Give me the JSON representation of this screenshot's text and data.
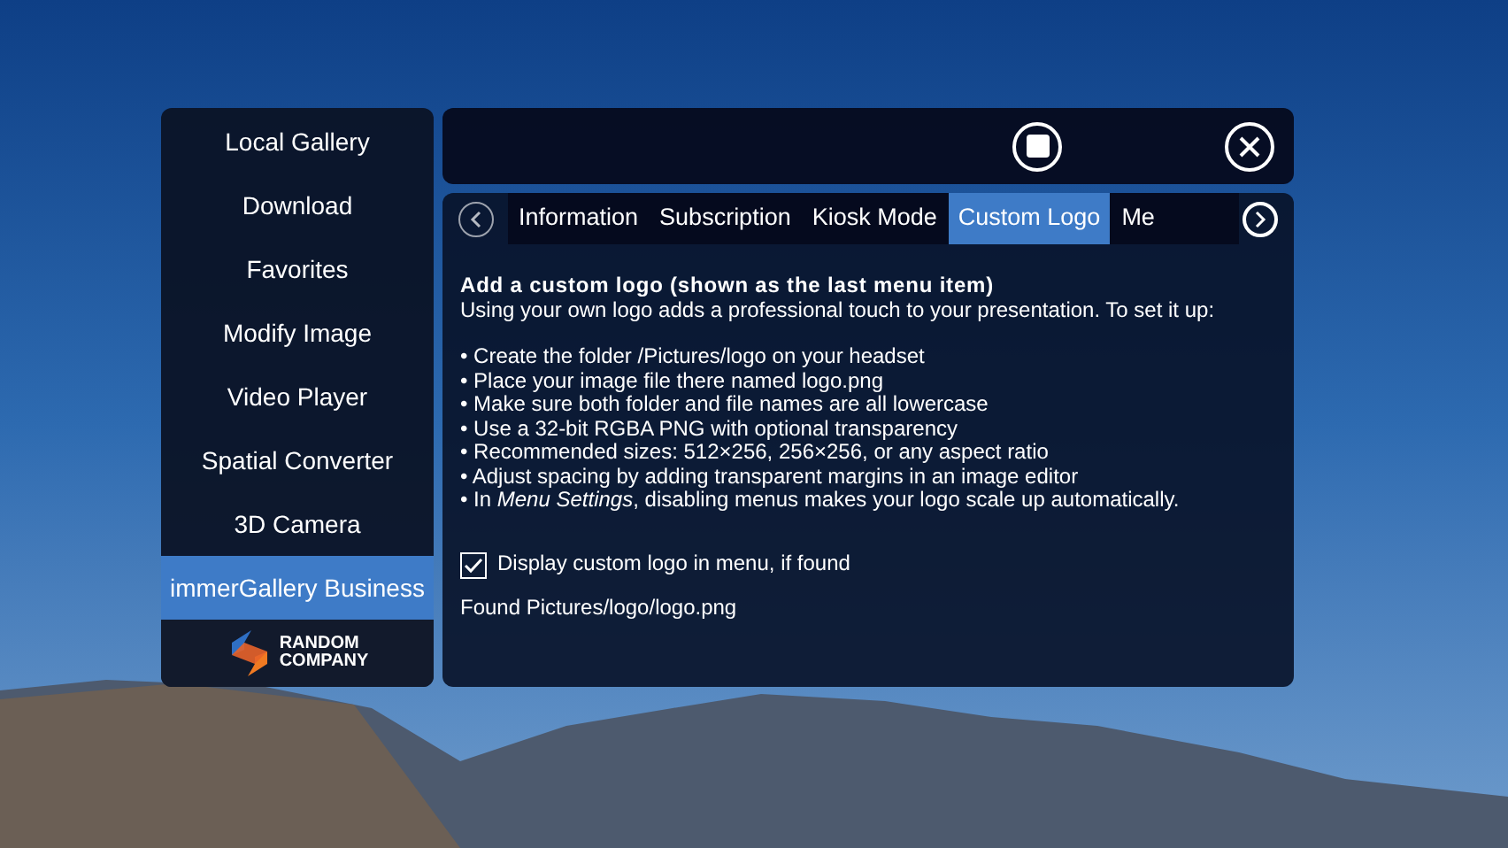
{
  "sidebar": {
    "items": [
      {
        "label": "Local Gallery",
        "selected": false
      },
      {
        "label": "Download",
        "selected": false
      },
      {
        "label": "Favorites",
        "selected": false
      },
      {
        "label": "Modify Image",
        "selected": false
      },
      {
        "label": "Video Player",
        "selected": false
      },
      {
        "label": "Spatial Converter",
        "selected": false
      },
      {
        "label": "3D Camera",
        "selected": false
      },
      {
        "label": "immerGallery Business",
        "selected": true
      }
    ],
    "logo": {
      "line_1": "RANDOM",
      "line_2": "COMPANY"
    }
  },
  "tabs": [
    {
      "label": "Information",
      "selected": false
    },
    {
      "label": "Subscription",
      "selected": false
    },
    {
      "label": "Kiosk Mode",
      "selected": false
    },
    {
      "label": "Custom Logo",
      "selected": true
    },
    {
      "label": "Me",
      "selected": false
    }
  ],
  "content": {
    "heading": "Add a custom logo (shown as the last menu item)",
    "intro": "Using your own logo adds a professional touch to your presentation. To set it up:",
    "bullets": [
      "• Create the folder /Pictures/logo on your headset",
      "• Place your image file there named logo.png",
      "• Make sure both folder and file names are all lowercase",
      "• Use a 32-bit RGBA PNG with optional transparency",
      "• Recommended sizes: 512×256, 256×256, or any aspect ratio",
      "• Adjust spacing by adding transparent margins in an image editor",
      "• In *Menu Settings*, disabling menus makes your logo scale up automatically."
    ],
    "checkbox": {
      "label": "Display custom logo in menu, if found",
      "checked": true
    },
    "status": "Found Pictures/logo/logo.png"
  }
}
